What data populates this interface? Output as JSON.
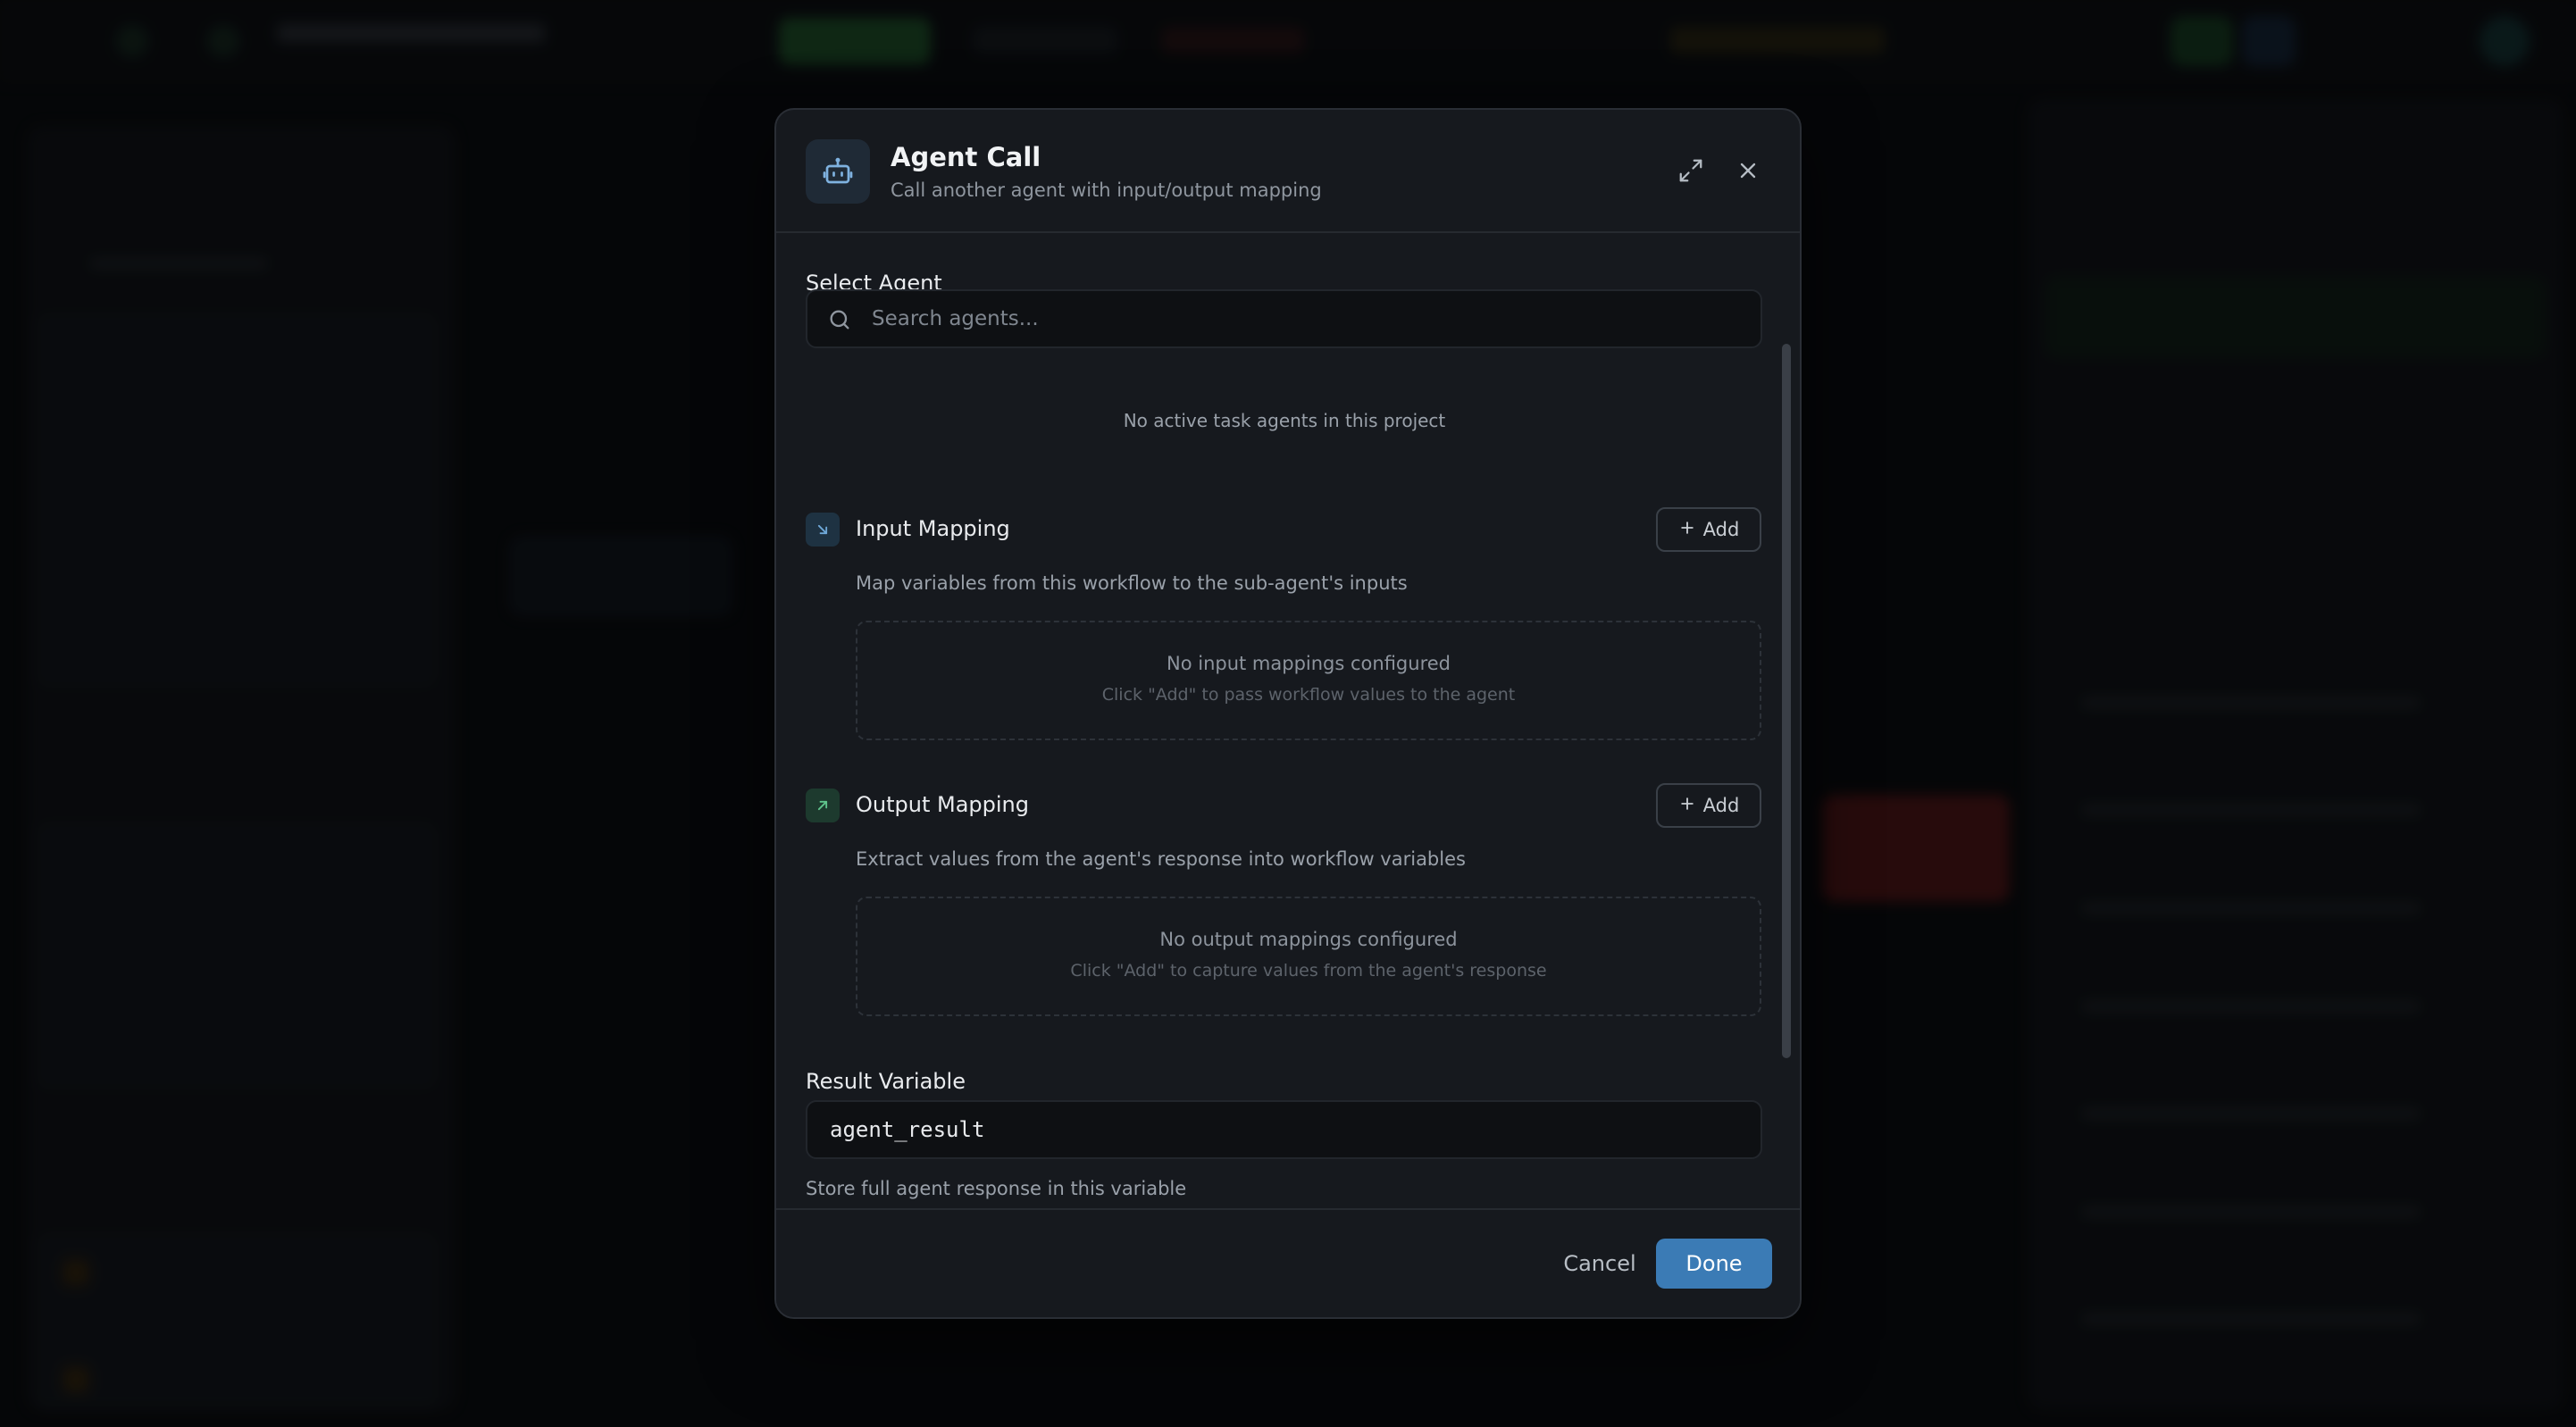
{
  "modal": {
    "title": "Agent Call",
    "subtitle": "Call another agent with input/output mapping",
    "icon": "robot-icon"
  },
  "select_agent": {
    "label": "Select Agent",
    "search_placeholder": "Search agents...",
    "search_value": "",
    "empty_message": "No active task agents in this project"
  },
  "input_mapping": {
    "title": "Input Mapping",
    "add_label": "Add",
    "description": "Map variables from this workflow to the sub-agent's inputs",
    "empty_title": "No input mappings configured",
    "empty_hint": "Click \"Add\" to pass workflow values to the agent"
  },
  "output_mapping": {
    "title": "Output Mapping",
    "add_label": "Add",
    "description": "Extract values from the agent's response into workflow variables",
    "empty_title": "No output mappings configured",
    "empty_hint": "Click \"Add\" to capture values from the agent's response"
  },
  "result_variable": {
    "label": "Result Variable",
    "value": "agent_result",
    "help": "Store full agent response in this variable"
  },
  "footer": {
    "cancel_label": "Cancel",
    "done_label": "Done"
  },
  "colors": {
    "accent": "#3b7bb5",
    "input_icon_bg": "#1e3242",
    "output_icon_bg": "#1d3a2e"
  }
}
